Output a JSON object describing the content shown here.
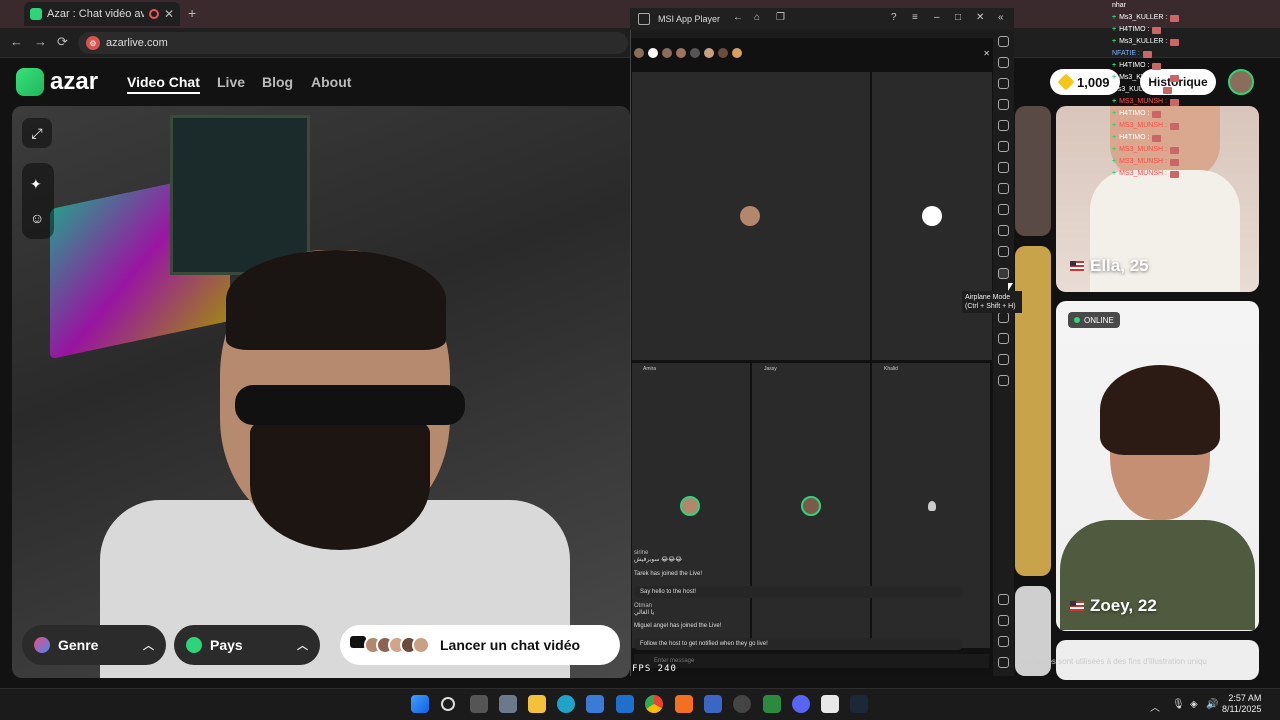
{
  "browser": {
    "tab_title": "Azar : Chat vidéo avec de n",
    "new_tab": "+",
    "url": "azarlive.com",
    "back": "←",
    "forward": "→",
    "reload": "⟳"
  },
  "site": {
    "brand": "azar",
    "nav": [
      "Video Chat",
      "Live",
      "Blog",
      "About"
    ],
    "gems": "1,009",
    "history_label": "Historique"
  },
  "controls": {
    "genre": "Genre",
    "pays": "Pays",
    "cta": "Lancer un chat vidéo"
  },
  "cards": [
    {
      "name": "Ella, 25",
      "online": false
    },
    {
      "name": "Zoey, 22",
      "online": true,
      "badge": "ONLINE"
    }
  ],
  "caption": "Les images sont utilisées à des fins d'illustration uniqu",
  "chat_overlay": [
    {
      "user": "nhar",
      "plus": false
    },
    {
      "user": "Ms3_KULLER :",
      "plus": true,
      "color": "#ffffff"
    },
    {
      "user": "H4TIMO :",
      "plus": true,
      "color": "#ffffff"
    },
    {
      "user": "Ms3_KULLER :",
      "plus": true,
      "color": "#ffffff"
    },
    {
      "user": "NFATIE :",
      "plus": false,
      "color": "#7fb6ff"
    },
    {
      "user": "H4TIMO :",
      "plus": true,
      "color": "#ffffff"
    },
    {
      "user": "Ms3_KULLER :",
      "plus": true,
      "color": "#ffffff"
    },
    {
      "user": "Ms3_KULLER :",
      "plus": false,
      "color": "#ffffff"
    },
    {
      "user": "MS3_MUNSH :",
      "plus": true,
      "color": "#ff4d4d"
    },
    {
      "user": "H4TIMO :",
      "plus": true,
      "color": "#ffffff"
    },
    {
      "user": "MS3_MUNSH :",
      "plus": true,
      "color": "#ff4d4d"
    },
    {
      "user": "H4TIMO :",
      "plus": true,
      "color": "#ffffff"
    },
    {
      "user": "MS3_MUNSH :",
      "plus": true,
      "color": "#ff4d4d"
    },
    {
      "user": "MS3_MUNSH :",
      "plus": true,
      "color": "#ff4d4d"
    },
    {
      "user": "MS3_MUNSH :",
      "plus": true,
      "color": "#ff4d4d"
    }
  ],
  "msi": {
    "title": "MSI App Player",
    "fps": "FPS 240",
    "tooltip_line1": "Airplane Mode",
    "tooltip_line2": "(Ctrl + Shift + H)",
    "cells": [
      "Amira",
      "Jassy",
      "Khalid"
    ],
    "chat": [
      {
        "type": "msg",
        "user": "sirine",
        "text": "سوبرفيش 😂😂😂"
      },
      {
        "type": "sys",
        "text": "Tarek has joined the Live!"
      },
      {
        "type": "bar",
        "text": "Say hello to the host!"
      },
      {
        "type": "msg",
        "user": "Otman",
        "text": "يا الغالي"
      },
      {
        "type": "sys",
        "text": "Miguel angel has joined the Live!"
      },
      {
        "type": "bar",
        "text": "Follow the host to get notified when they go live!"
      }
    ],
    "input_placeholder": "Enter message"
  },
  "taskbar": {
    "time": "2:57 AM",
    "date": "8/11/2025"
  },
  "colors": {
    "accent": "#2fd37a",
    "page_bg": "#121212"
  }
}
